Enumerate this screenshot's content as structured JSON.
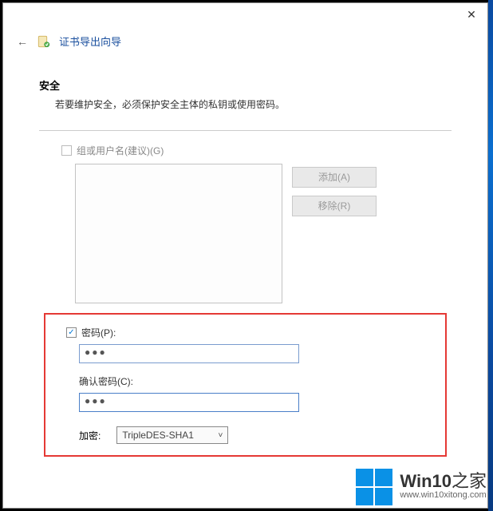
{
  "titlebar": {
    "close": "✕"
  },
  "header": {
    "back_arrow": "←",
    "title": "证书导出向导"
  },
  "security": {
    "heading": "安全",
    "description": "若要维护安全，必须保护安全主体的私钥或使用密码。"
  },
  "group": {
    "checkbox_label": "组或用户名(建议)(G)"
  },
  "buttons": {
    "add": "添加(A)",
    "remove": "移除(R)"
  },
  "password": {
    "checkbox_label": "密码(P):",
    "value_mask": "●●●",
    "confirm_label": "确认密码(C):",
    "confirm_value_mask": "●●●"
  },
  "encryption": {
    "label": "加密:",
    "selected": "TripleDES-SHA1"
  },
  "watermark": {
    "brand_en": "Win10",
    "brand_zh": "之家",
    "url": "www.win10xitong.com"
  }
}
